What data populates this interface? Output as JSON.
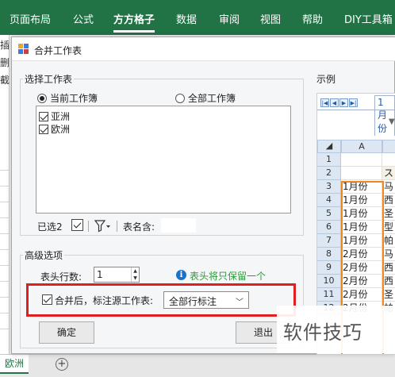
{
  "ribbon": {
    "color": "#217346",
    "tabs": [
      {
        "label": "页面布局",
        "active": false
      },
      {
        "label": "公式",
        "active": false
      },
      {
        "label": "方方格子",
        "active": true
      },
      {
        "label": "数据",
        "active": false
      },
      {
        "label": "审阅",
        "active": false
      },
      {
        "label": "视图",
        "active": false
      },
      {
        "label": "帮助",
        "active": false
      },
      {
        "label": "DIY工具箱",
        "active": false
      }
    ]
  },
  "background": {
    "left_fragments": [
      "插",
      "删",
      "截"
    ],
    "sheet_tab": "欧洲",
    "add_sheet_icon": "plus-circle-icon"
  },
  "dialog": {
    "title": "合并工作表",
    "icon": "merge-sheets-icon",
    "select_group": {
      "legend": "选择工作表",
      "radio_current": "当前工作簿",
      "radio_all": "全部工作簿",
      "selected_radio": "当前工作簿",
      "sheets": [
        {
          "label": "亚洲",
          "checked": true
        },
        {
          "label": "欧洲",
          "checked": true
        }
      ],
      "selected_count": "已选2",
      "filter_icon": "filter-icon",
      "name_contains_label": "表名含:",
      "name_contains_value": ""
    },
    "advanced_group": {
      "legend": "高级选项",
      "header_rows_label": "表头行数:",
      "header_rows_value": "1",
      "info_icon": "info-icon",
      "info_text": "表头将只保留一个",
      "mark_source_label": "合并后，标注源工作表:",
      "mark_source_checked": true,
      "mark_source_option": "全部行标注",
      "highlight_color": "#e02020"
    },
    "buttons": {
      "ok": "确定",
      "exit": "退出"
    },
    "preview": {
      "legend": "示例",
      "sheet_name": "1月份",
      "col_header": "A",
      "row_numbers": [
        "1",
        "2",
        "3",
        "4",
        "5",
        "6",
        "7",
        "8",
        "9",
        "10",
        "11",
        "12"
      ],
      "col_a": [
        "",
        "",
        "1月份",
        "1月份",
        "1月份",
        "1月份",
        "1月份",
        "2月份",
        "2月份",
        "2月份",
        "2月份",
        "2月份"
      ],
      "col_b": [
        "",
        "ス",
        "马",
        "西",
        "圣",
        "型",
        "帕",
        "马",
        "西",
        "西",
        "圣",
        "帕"
      ],
      "orange_color": "#f0891a"
    }
  },
  "watermark": "软件技巧"
}
